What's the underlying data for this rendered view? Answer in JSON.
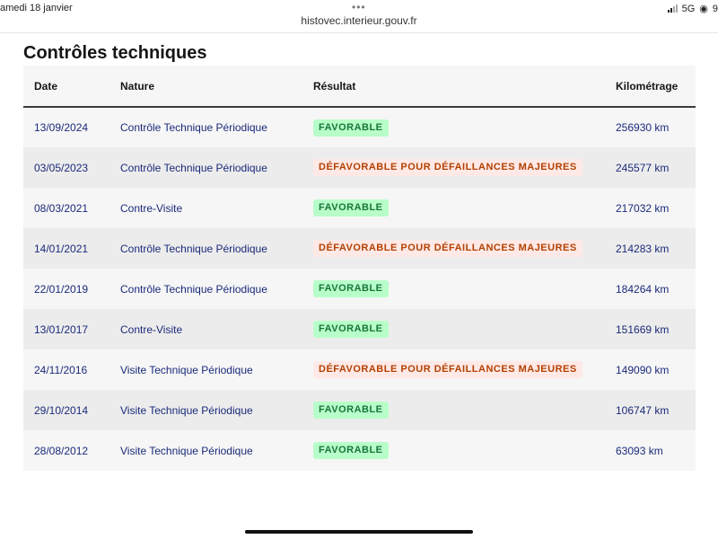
{
  "status_bar": {
    "time_date": "amedi 18 janvier",
    "network": "5G",
    "battery_text": "9"
  },
  "browser": {
    "url": "histovec.interieur.gouv.fr"
  },
  "section": {
    "title": "Contrôles techniques"
  },
  "table": {
    "headers": {
      "date": "Date",
      "nature": "Nature",
      "result": "Résultat",
      "mileage": "Kilométrage"
    },
    "rows": [
      {
        "date": "13/09/2024",
        "nature": "Contrôle Technique Périodique",
        "result": "FAVORABLE",
        "status": "favorable",
        "mileage": "256930 km"
      },
      {
        "date": "03/05/2023",
        "nature": "Contrôle Technique Périodique",
        "result": "DÉFAVORABLE POUR DÉFAILLANCES MAJEURES",
        "status": "defavorable",
        "mileage": "245577 km"
      },
      {
        "date": "08/03/2021",
        "nature": "Contre-Visite",
        "result": "FAVORABLE",
        "status": "favorable",
        "mileage": "217032 km"
      },
      {
        "date": "14/01/2021",
        "nature": "Contrôle Technique Périodique",
        "result": "DÉFAVORABLE POUR DÉFAILLANCES MAJEURES",
        "status": "defavorable",
        "mileage": "214283 km"
      },
      {
        "date": "22/01/2019",
        "nature": "Contrôle Technique Périodique",
        "result": "FAVORABLE",
        "status": "favorable",
        "mileage": "184264 km"
      },
      {
        "date": "13/01/2017",
        "nature": "Contre-Visite",
        "result": "FAVORABLE",
        "status": "favorable",
        "mileage": "151669 km"
      },
      {
        "date": "24/11/2016",
        "nature": "Visite Technique Périodique",
        "result": "DÉFAVORABLE POUR DÉFAILLANCES MAJEURES",
        "status": "defavorable",
        "mileage": "149090 km"
      },
      {
        "date": "29/10/2014",
        "nature": "Visite Technique Périodique",
        "result": "FAVORABLE",
        "status": "favorable",
        "mileage": "106747 km"
      },
      {
        "date": "28/08/2012",
        "nature": "Visite Technique Périodique",
        "result": "FAVORABLE",
        "status": "favorable",
        "mileage": "63093 km"
      }
    ]
  },
  "colors": {
    "favorable_bg": "#b8fec9",
    "favorable_text": "#18753c",
    "defavorable_bg": "#ffe9e6",
    "defavorable_text": "#b34000",
    "link_text": "#1b2a7a"
  },
  "icons": {
    "menu_dots": "more-dots-icon",
    "signal": "cellular-signal-icon",
    "location": "location-icon"
  }
}
